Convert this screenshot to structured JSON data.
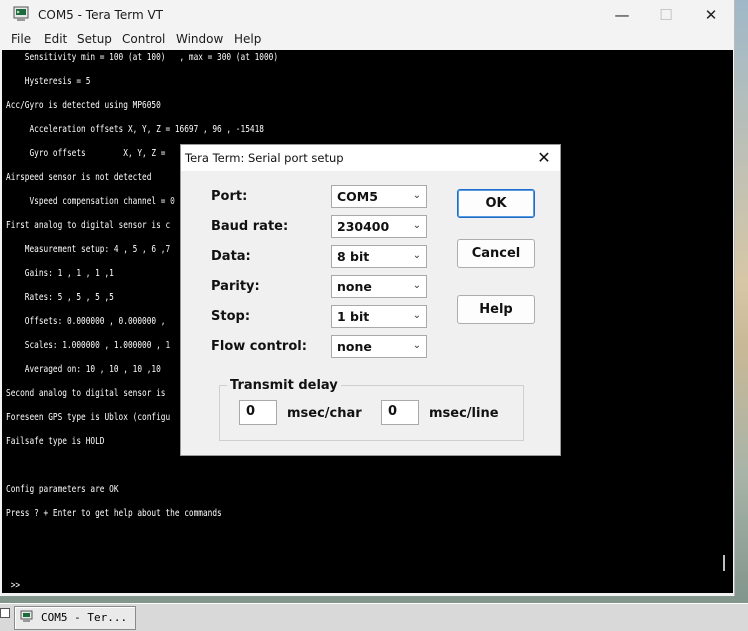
{
  "window": {
    "title": "COM5 - Tera Term VT",
    "min_glyph": "—",
    "max_glyph": "☐",
    "close_glyph": "✕"
  },
  "menu": [
    "File",
    "Edit",
    "Setup",
    "Control",
    "Window",
    "Help"
  ],
  "terminal": {
    "lines": [
      "    Sensitivity min = 100 (at 100)   , max = 300 (at 1000)",
      "",
      "    Hysteresis = 5",
      "",
      "Acc/Gyro is detected using MP6050",
      "",
      "     Acceleration offsets X, Y, Z = 16697 , 96 , -15418",
      "",
      "     Gyro offsets        X, Y, Z =",
      "",
      "Airspeed sensor is not detected",
      "",
      "     Vspeed compensation channel = 0",
      "",
      "First analog to digital sensor is c",
      "",
      "    Measurement setup: 4 , 5 , 6 ,7",
      "",
      "    Gains: 1 , 1 , 1 ,1",
      "",
      "    Rates: 5 , 5 , 5 ,5",
      "",
      "    Offsets: 0.000000 , 0.000000 ,",
      "",
      "    Scales: 1.000000 , 1.000000 , 1",
      "",
      "    Averaged on: 10 , 10 , 10 ,10",
      "",
      "Second analog to digital sensor is",
      "",
      "Foreseen GPS type is Ublox (configu",
      "",
      "Failsafe type is HOLD",
      "",
      "",
      "",
      "Config parameters are OK",
      "",
      "Press ? + Enter to get help about the commands",
      "",
      "",
      "",
      "",
      "",
      " >>"
    ]
  },
  "dialog": {
    "title": "Tera Term: Serial port setup",
    "close_glyph": "✕",
    "fields": [
      {
        "label": "Port:",
        "value": "COM5"
      },
      {
        "label": "Baud rate:",
        "value": "230400"
      },
      {
        "label": "Data:",
        "value": "8 bit"
      },
      {
        "label": "Parity:",
        "value": "none"
      },
      {
        "label": "Stop:",
        "value": "1 bit"
      },
      {
        "label": "Flow control:",
        "value": "none"
      }
    ],
    "buttons": {
      "ok": "OK",
      "cancel": "Cancel",
      "help": "Help"
    },
    "transmit_delay": {
      "legend": "Transmit delay",
      "char_value": "0",
      "char_unit": "msec/char",
      "line_value": "0",
      "line_unit": "msec/line"
    }
  },
  "taskbar": {
    "item_label": "COM5 - Ter..."
  },
  "icons": [
    "app-icon",
    "chevron-down-icon",
    "close-icon"
  ],
  "colors": {
    "terminal_bg": "#000000",
    "terminal_fg": "#ffffff",
    "accent": "#1e6ec9"
  }
}
